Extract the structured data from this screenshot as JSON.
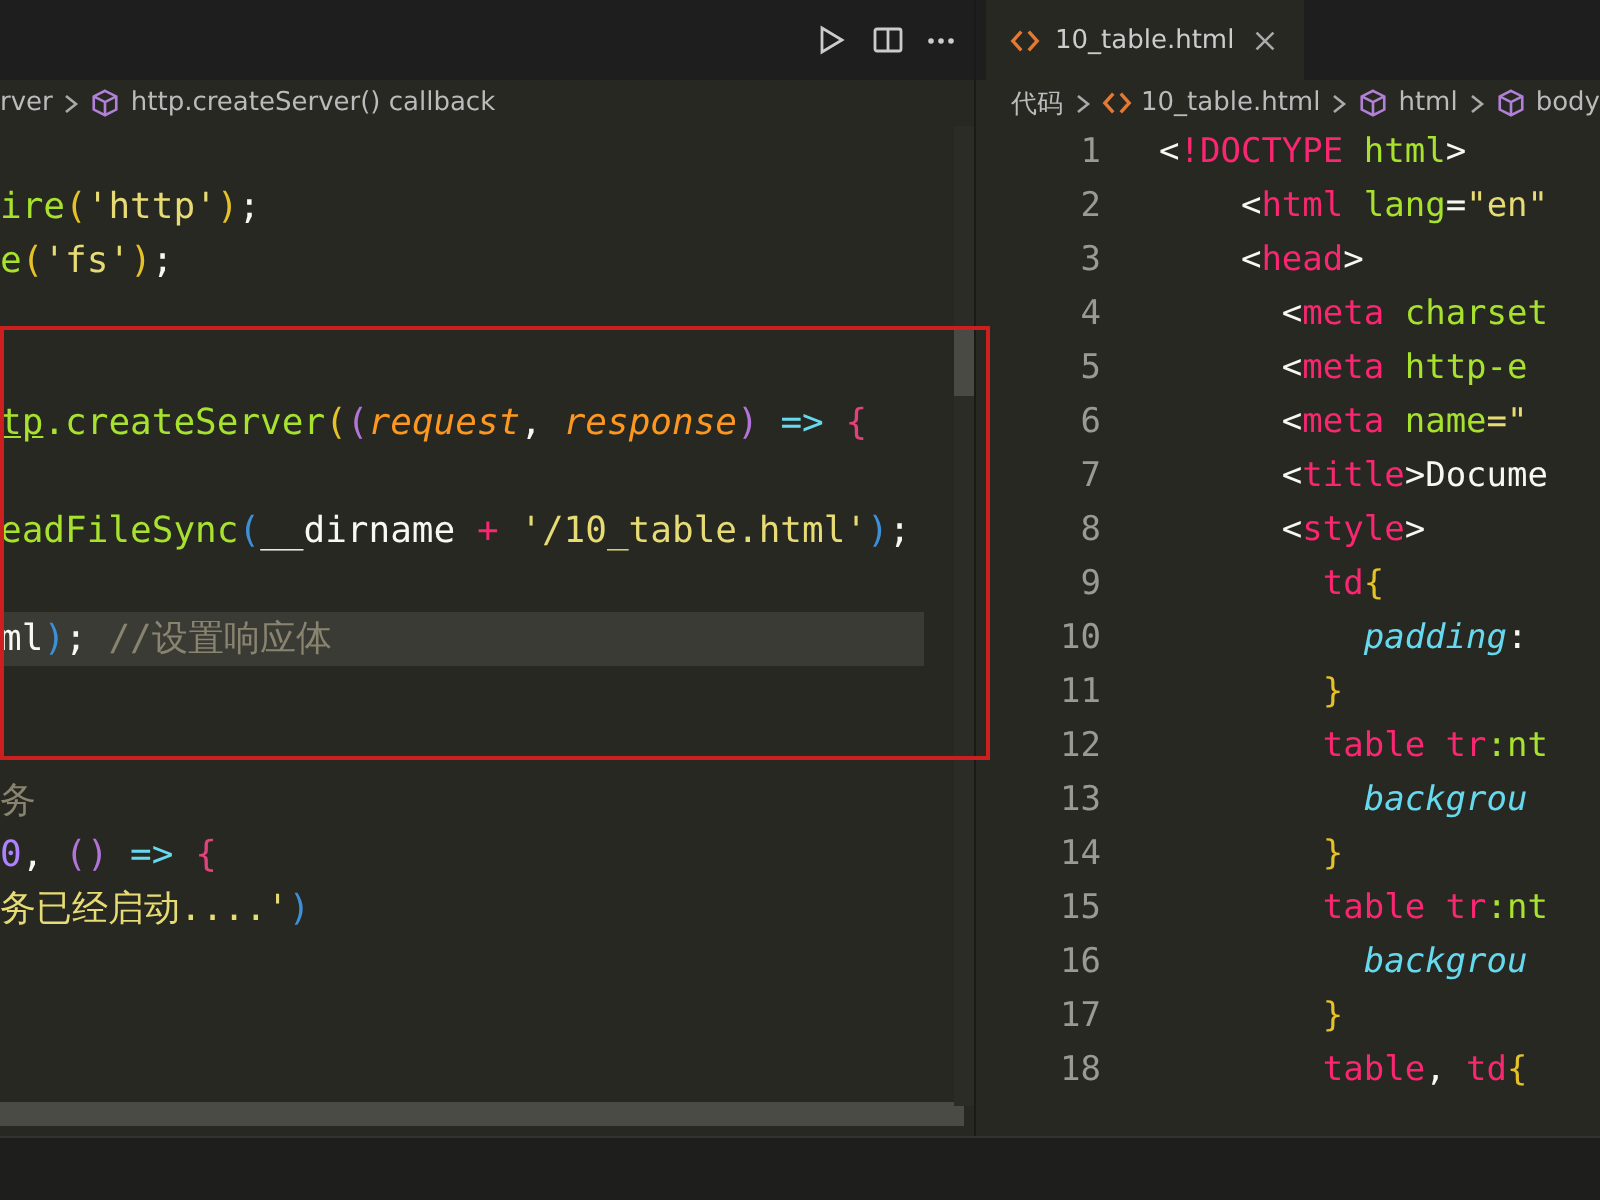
{
  "left_editor": {
    "breadcrumbs": [
      {
        "text": "rver",
        "kind": "folder"
      },
      {
        "text": "http.createServer() callback",
        "kind": "symbol"
      }
    ],
    "lines": [
      {
        "current": false
      },
      {
        "current": false,
        "tokens": [
          {
            "text": "ire",
            "kind": "fn"
          },
          {
            "text": "(",
            "kind": "brace1"
          },
          {
            "text": "'http'",
            "kind": "str"
          },
          {
            "text": ")",
            "kind": "brace1"
          },
          {
            "text": ";",
            "kind": "plain"
          }
        ]
      },
      {
        "current": false,
        "tokens": [
          {
            "text": "e",
            "kind": "fn"
          },
          {
            "text": "(",
            "kind": "brace1"
          },
          {
            "text": "'fs'",
            "kind": "str"
          },
          {
            "text": ")",
            "kind": "brace1"
          },
          {
            "text": ";",
            "kind": "plain"
          }
        ]
      },
      {
        "current": false
      },
      {
        "current": false
      },
      {
        "current": false,
        "tokens": [
          {
            "text": "tp",
            "kind": "ref"
          },
          {
            "text": ".createServer",
            "kind": "fn"
          },
          {
            "text": "(",
            "kind": "brace1"
          },
          {
            "text": "(",
            "kind": "brace2"
          },
          {
            "text": "request",
            "kind": "param"
          },
          {
            "text": ", ",
            "kind": "plain"
          },
          {
            "text": "response",
            "kind": "param"
          },
          {
            "text": ")",
            "kind": "brace2"
          },
          {
            "text": " => ",
            "kind": "arrow"
          },
          {
            "text": "{",
            "kind": "brace3"
          }
        ]
      },
      {
        "current": false
      },
      {
        "current": false,
        "tokens": [
          {
            "text": "eadFileSync",
            "kind": "fn"
          },
          {
            "text": "(",
            "kind": "brace4"
          },
          {
            "text": "__dirname",
            "kind": "plain"
          },
          {
            "text": " + ",
            "kind": "op"
          },
          {
            "text": "'/10_table.html'",
            "kind": "str"
          },
          {
            "text": ")",
            "kind": "brace4"
          },
          {
            "text": ";",
            "kind": "plain"
          }
        ]
      },
      {
        "current": false
      },
      {
        "current": true,
        "tokens": [
          {
            "text": "ml",
            "kind": "plain"
          },
          {
            "text": ")",
            "kind": "brace4"
          },
          {
            "text": "; ",
            "kind": "plain"
          },
          {
            "text": "//设置响应体",
            "kind": "comment"
          }
        ]
      },
      {
        "current": false
      },
      {
        "current": false
      },
      {
        "current": false,
        "tokens": [
          {
            "text": "务",
            "kind": "comment"
          }
        ]
      },
      {
        "current": false,
        "tokens": [
          {
            "text": "0",
            "kind": "num"
          },
          {
            "text": ", ",
            "kind": "plain"
          },
          {
            "text": "()",
            "kind": "brace2"
          },
          {
            "text": " => ",
            "kind": "arrow"
          },
          {
            "text": "{",
            "kind": "brace3"
          }
        ]
      },
      {
        "current": false,
        "tokens": [
          {
            "text": "务已经启动....'",
            "kind": "str"
          },
          {
            "text": ")",
            "kind": "brace4"
          }
        ]
      }
    ]
  },
  "right_editor": {
    "tab": {
      "label": "10_table.html",
      "selected": true
    },
    "breadcrumbs": [
      {
        "text": "代码",
        "kind": "folder"
      },
      {
        "text": "10_table.html",
        "kind": "file"
      },
      {
        "text": "html",
        "kind": "symbol"
      },
      {
        "text": "body",
        "kind": "symbol"
      }
    ],
    "lines": [
      {
        "number": "1",
        "tokens": [
          {
            "text": "<",
            "kind": "plain"
          },
          {
            "text": "!DOCTYPE",
            "kind": "tag"
          },
          {
            "text": " html",
            "kind": "attr"
          },
          {
            "text": ">",
            "kind": "plain"
          }
        ]
      },
      {
        "number": "2",
        "tokens": [
          {
            "text": "    <",
            "kind": "plain"
          },
          {
            "text": "html",
            "kind": "tag"
          },
          {
            "text": " lang",
            "kind": "attr"
          },
          {
            "text": "=",
            "kind": "plain"
          },
          {
            "text": "\"en\"",
            "kind": "str"
          }
        ]
      },
      {
        "number": "3",
        "tokens": [
          {
            "text": "    <",
            "kind": "plain"
          },
          {
            "text": "head",
            "kind": "tag"
          },
          {
            "text": ">",
            "kind": "plain"
          }
        ]
      },
      {
        "number": "4",
        "tokens": [
          {
            "text": "      <",
            "kind": "plain"
          },
          {
            "text": "meta",
            "kind": "tag"
          },
          {
            "text": " charset",
            "kind": "attr"
          }
        ]
      },
      {
        "number": "5",
        "tokens": [
          {
            "text": "      <",
            "kind": "plain"
          },
          {
            "text": "meta",
            "kind": "tag"
          },
          {
            "text": " http-e",
            "kind": "attr"
          }
        ]
      },
      {
        "number": "6",
        "tokens": [
          {
            "text": "      <",
            "kind": "plain"
          },
          {
            "text": "meta",
            "kind": "tag"
          },
          {
            "text": " name",
            "kind": "attr"
          },
          {
            "text": "=\"",
            "kind": "str"
          }
        ]
      },
      {
        "number": "7",
        "tokens": [
          {
            "text": "      <",
            "kind": "plain"
          },
          {
            "text": "title",
            "kind": "tag"
          },
          {
            "text": ">Docume",
            "kind": "plain"
          }
        ]
      },
      {
        "number": "8",
        "tokens": [
          {
            "text": "      <",
            "kind": "plain"
          },
          {
            "text": "style",
            "kind": "tag"
          },
          {
            "text": ">",
            "kind": "plain"
          }
        ]
      },
      {
        "number": "9",
        "tokens": [
          {
            "text": "        td",
            "kind": "tag"
          },
          {
            "text": "{",
            "kind": "brace1"
          }
        ]
      },
      {
        "number": "10",
        "tokens": [
          {
            "text": "          padding",
            "kind": "prop"
          },
          {
            "text": ":",
            "kind": "plain"
          }
        ]
      },
      {
        "number": "11",
        "tokens": [
          {
            "text": "        }",
            "kind": "brace1"
          }
        ]
      },
      {
        "number": "12",
        "tokens": [
          {
            "text": "        table tr",
            "kind": "tag"
          },
          {
            "text": ":nt",
            "kind": "attr"
          }
        ]
      },
      {
        "number": "13",
        "tokens": [
          {
            "text": "          backgrou",
            "kind": "prop"
          }
        ]
      },
      {
        "number": "14",
        "tokens": [
          {
            "text": "        }",
            "kind": "brace1"
          }
        ]
      },
      {
        "number": "15",
        "tokens": [
          {
            "text": "        table tr",
            "kind": "tag"
          },
          {
            "text": ":nt",
            "kind": "attr"
          }
        ]
      },
      {
        "number": "16",
        "tokens": [
          {
            "text": "          backgrou",
            "kind": "prop"
          }
        ]
      },
      {
        "number": "17",
        "tokens": [
          {
            "text": "        }",
            "kind": "brace1"
          }
        ]
      },
      {
        "number": "18",
        "tokens": [
          {
            "text": "        table",
            "kind": "tag"
          },
          {
            "text": ", ",
            "kind": "plain"
          },
          {
            "text": "td",
            "kind": "tag"
          },
          {
            "text": "{",
            "kind": "brace1"
          }
        ]
      }
    ]
  }
}
